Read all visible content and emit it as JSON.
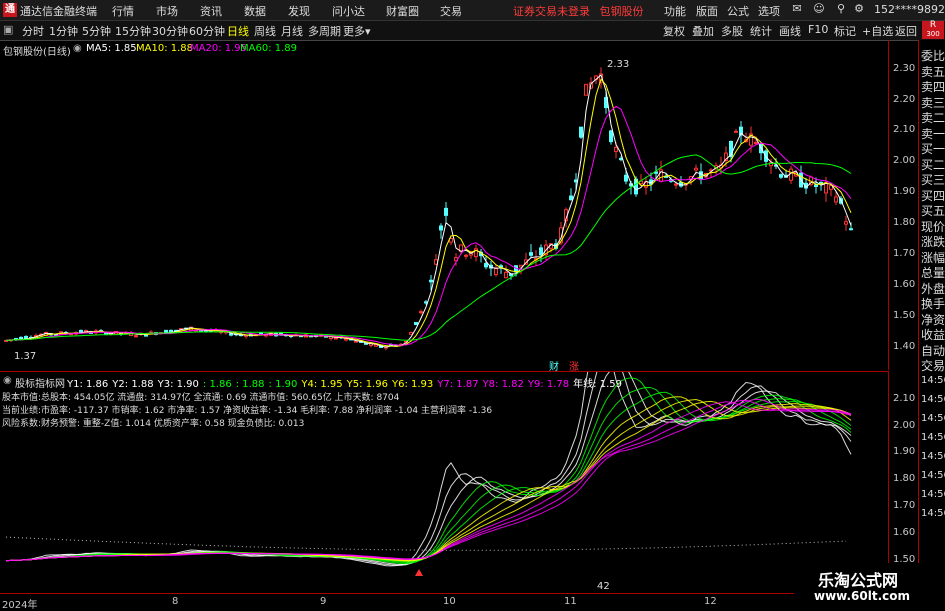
{
  "menubar": {
    "logo": "通",
    "app_name": "通达信金融终端",
    "menus": [
      "行情",
      "市场",
      "资讯",
      "数据",
      "发现",
      "问小达",
      "财富圈",
      "交易"
    ],
    "warning": "证券交易未登录",
    "stock_link": "包钢股份",
    "right_menus": [
      "功能",
      "版面",
      "公式",
      "选项"
    ],
    "user": "152****9892"
  },
  "toolbar": {
    "periods": [
      "分时",
      "1分钟",
      "5分钟",
      "15分钟",
      "30分钟",
      "60分钟",
      "日线",
      "周线",
      "月线",
      "多周期",
      "更多"
    ],
    "selected": "日线",
    "right_items": [
      "复权",
      "叠加",
      "多股",
      "统计",
      "画线",
      "F10",
      "标记",
      "+自选",
      "返回"
    ]
  },
  "main_chart": {
    "stock_title": "包钢股份(日线)",
    "ma5": "MA5: 1.85",
    "ma10": "MA10: 1.88",
    "ma20": "MA20: 1.95",
    "ma60": "MA60: 1.89",
    "high_label": "2.33",
    "low_label": "1.37",
    "badge_cai": "财",
    "badge_zhang": "涨",
    "axis_labels": [
      "2.30",
      "2.20",
      "2.10",
      "2.00",
      "1.90",
      "1.80",
      "1.70",
      "1.60",
      "1.50",
      "1.40"
    ]
  },
  "sub_chart": {
    "title": "股标指标网",
    "y_values": [
      {
        "t": "Y1: 1.86",
        "c": "#ffffff"
      },
      {
        "t": "Y2: 1.88",
        "c": "#ffffff"
      },
      {
        "t": "Y3: 1.90",
        "c": "#ffffff"
      },
      {
        "t": ": 1.86",
        "c": "#00ff00"
      },
      {
        "t": ": 1.88",
        "c": "#00ff00"
      },
      {
        "t": ": 1.90",
        "c": "#00ff00"
      },
      {
        "t": "Y4: 1.95",
        "c": "#ffff00"
      },
      {
        "t": "Y5: 1.96",
        "c": "#ffff00"
      },
      {
        "t": "Y6: 1.93",
        "c": "#ffff00"
      },
      {
        "t": "Y7: 1.87",
        "c": "#ff00ff"
      },
      {
        "t": "Y8: 1.82",
        "c": "#ff00ff"
      },
      {
        "t": "Y9: 1.78",
        "c": "#ff00ff"
      },
      {
        "t": "年线: 1.59",
        "c": "#ffffff"
      }
    ],
    "info_lines": [
      "股本市值:总股本: 454.05亿 流通盘: 314.97亿 全流通: 0.69 流通市值: 560.65亿 上市天数: 8704",
      "当前业绩:市盈率: -117.37 市销率: 1.62 市净率: 1.57 净资收益率: -1.34 毛利率: 7.88 净利润率 -1.04 主营利润率 -1.36",
      "风险系数:财务预警: 重整-Z值: 1.014 优质资产率: 0.58 现金负债比: 0.013"
    ],
    "axis_labels": [
      "2.10",
      "2.00",
      "1.90",
      "1.80",
      "1.70",
      "1.60",
      "1.50"
    ],
    "marker": "42"
  },
  "right_panel": {
    "corner": "R",
    "corner_sub": "300",
    "items": [
      "委比",
      "卖五",
      "卖四",
      "卖三",
      "卖二",
      "卖一",
      "买一",
      "买二",
      "买三",
      "买四",
      "买五",
      "现价",
      "涨跌",
      "涨幅",
      "总量",
      "外盘",
      "换手",
      "净资",
      "收益",
      "自动",
      "交易"
    ],
    "times": [
      "14:56",
      "14:56",
      "14:56",
      "14:56",
      "14:56",
      "14:56",
      "14:56",
      "14:56"
    ]
  },
  "xaxis": {
    "labels": [
      "2024年",
      "8",
      "9",
      "10",
      "11",
      "12"
    ]
  },
  "watermark": {
    "line1": "乐淘公式网",
    "line2": "www.60lt.com"
  },
  "colors": {
    "up": "#ff3232",
    "down": "#54ffff",
    "ma5": "#ffffff",
    "ma10": "#ffff00",
    "ma20": "#ff00ff",
    "ma60": "#00ff00"
  }
}
